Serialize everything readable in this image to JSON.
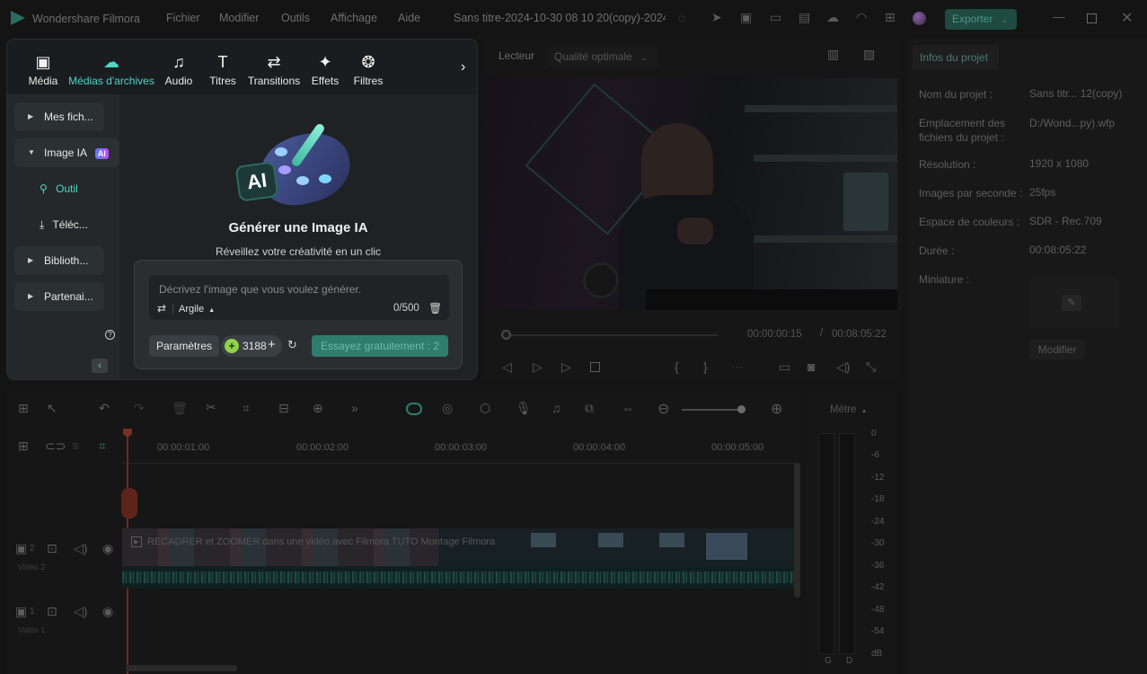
{
  "app": {
    "name": "Wondershare Filmora",
    "menu": [
      "Fichier",
      "Modifier",
      "Outils",
      "Affichage",
      "Aide"
    ],
    "project_title": "Sans titre-2024-10-30 08 10 20(copy)-2024-...",
    "export_label": "Exporter"
  },
  "media": {
    "tabs": [
      {
        "label": "Média",
        "icon": "image-icon"
      },
      {
        "label": "Médias d'archives",
        "icon": "cloud-image-icon"
      },
      {
        "label": "Audio",
        "icon": "music-note-icon"
      },
      {
        "label": "Titres",
        "icon": "text-t-icon"
      },
      {
        "label": "Transitions",
        "icon": "transition-arrows-icon"
      },
      {
        "label": "Effets",
        "icon": "sparkle-icon"
      },
      {
        "label": "Filtres",
        "icon": "filter-circles-icon"
      }
    ],
    "sidebar": {
      "my_files": "Mes fich...",
      "ai_image": "Image IA",
      "ai_badge": "AI",
      "tool": "Outil",
      "download": "Téléc...",
      "library": "Biblioth...",
      "partners": "Partenai..."
    },
    "ai": {
      "heading": "Générer une Image IA",
      "subheading": "Réveillez votre créativité en un clic",
      "placeholder": "Décrivez l'image que vous voulez générer.",
      "style": "Argile",
      "counter": "0/500",
      "settings_label": "Paramètres",
      "credits": "3188",
      "try_label": "Essayez gratuitement : 2",
      "logo_text": "AI"
    }
  },
  "player": {
    "tab": "Lecteur",
    "quality": "Qualité optimale",
    "current_time": "00:00:00:15",
    "separator": "/",
    "total_time": "00:08:05:22"
  },
  "properties": {
    "tab": "Infos du projet",
    "rows": [
      {
        "label": "Nom du projet :",
        "value": "Sans titr... 12(copy)"
      },
      {
        "label": "Emplacement des fichiers du projet :",
        "value": "D:/Wond...py).wfp"
      },
      {
        "label": "Résolution :",
        "value": "1920 x 1080"
      },
      {
        "label": "Images par seconde :",
        "value": "25fps"
      },
      {
        "label": "Espace de couleurs :",
        "value": "SDR - Rec.709"
      },
      {
        "label": "Durée :",
        "value": "00:08:05:22"
      },
      {
        "label": "Miniature :",
        "value": ""
      }
    ],
    "modify_label": "Modifier"
  },
  "timeline": {
    "ruler": [
      "00:00:01:00",
      "00:00:02:00",
      "00:00:03:00",
      "00:00:04:00",
      "00:00:05:00"
    ],
    "clip_title": "RECADRER et ZOOMER dans une vidéo avec Filmora  TUTO Montage Filmora",
    "track2_num": "2",
    "track2_label": "Vidéo 2",
    "track1_num": "1",
    "track1_label": "Vidéo 1"
  },
  "meter": {
    "title": "Mètre",
    "scale": [
      "0",
      "-6",
      "-12",
      "-18",
      "-24",
      "-30",
      "-36",
      "-42",
      "-48",
      "-54",
      "dB"
    ],
    "left": "G",
    "right": "D"
  },
  "colors": {
    "accent": "#4dd6c4",
    "export_green": "#2f7d6c",
    "playhead": "#c0392b"
  }
}
